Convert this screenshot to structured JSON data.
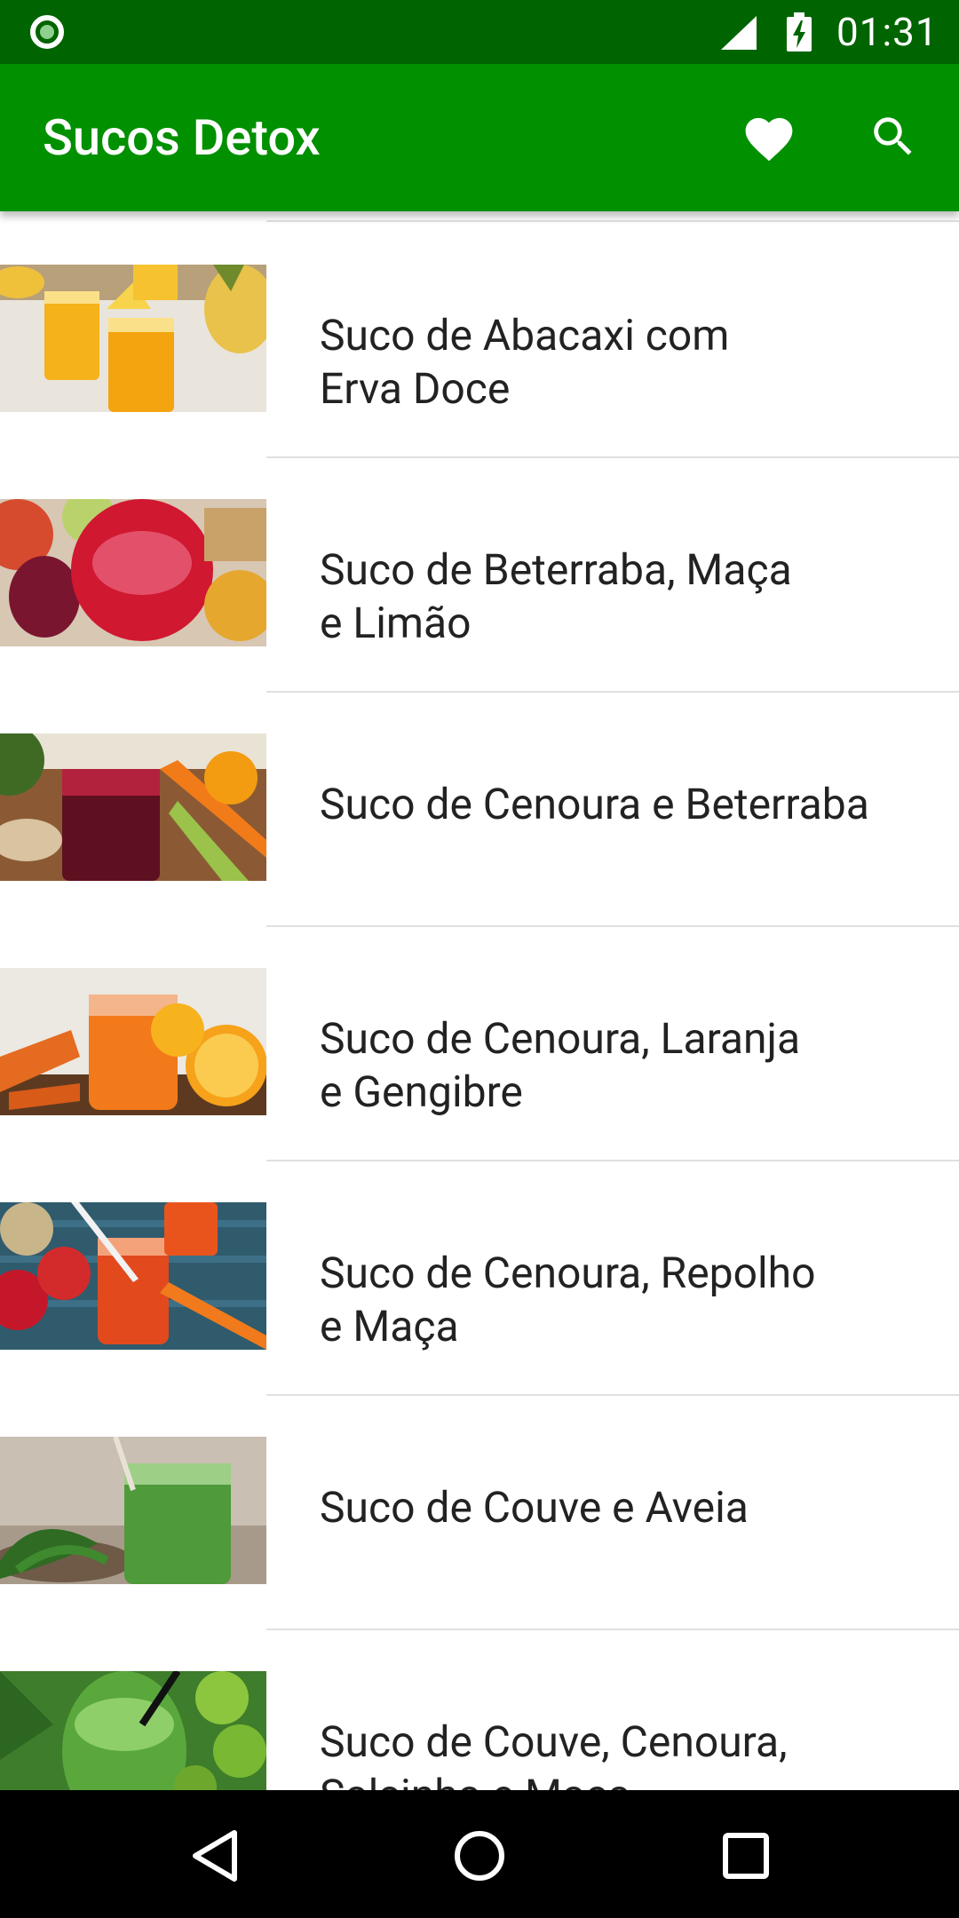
{
  "status_bar": {
    "time": "01:31",
    "icons": [
      "notification-dot-icon",
      "signal-icon",
      "battery-charging-icon"
    ]
  },
  "app_bar": {
    "title": "Sucos Detox",
    "actions": [
      {
        "name": "favorites",
        "icon": "heart-icon"
      },
      {
        "name": "search",
        "icon": "search-icon"
      }
    ],
    "color": "#009000"
  },
  "list": {
    "items": [
      {
        "title": "Suco de Abacaxi com\nErva Doce"
      },
      {
        "title": "Suco de Beterraba, Maça\ne Limão"
      },
      {
        "title": "Suco de Cenoura e Beterraba"
      },
      {
        "title": "Suco de Cenoura, Laranja\ne Gengibre"
      },
      {
        "title": "Suco de Cenoura, Repolho\ne Maça"
      },
      {
        "title": "Suco de Couve e Aveia"
      },
      {
        "title": "Suco de Couve, Cenoura,\nSalsinha e Maça"
      }
    ]
  },
  "nav_bar": {
    "buttons": [
      "back-icon",
      "home-icon",
      "recents-icon"
    ]
  },
  "colors": {
    "status_bar": "#006400",
    "app_bar": "#009000",
    "divider": "#e0e0e0",
    "text": "#222222"
  }
}
